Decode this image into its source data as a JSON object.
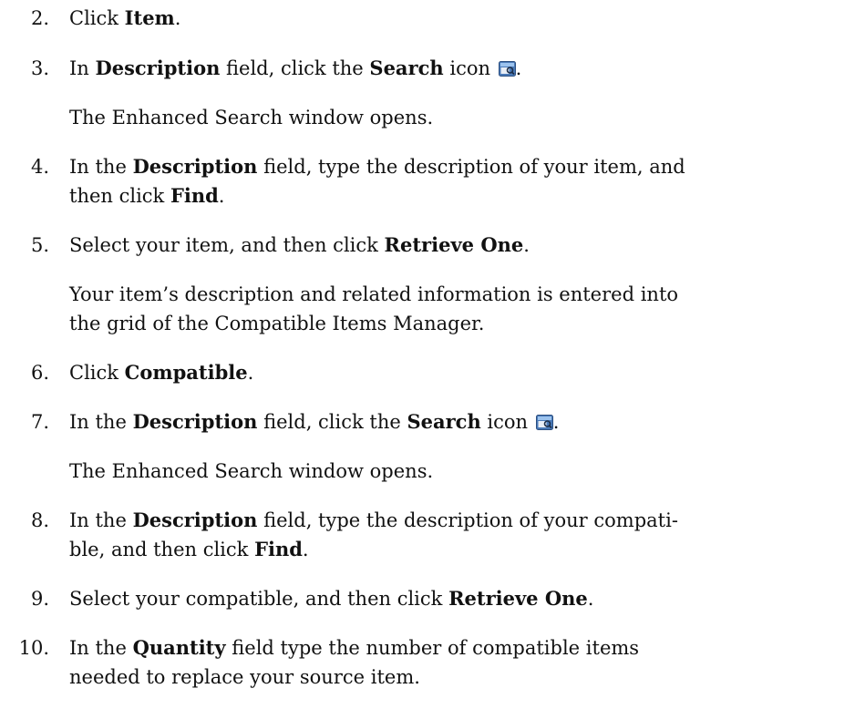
{
  "steps": [
    {
      "num": "2.",
      "parts": [
        "Click ",
        "Item",
        "."
      ]
    },
    {
      "num": "3.",
      "parts": [
        "In ",
        "Description",
        " field, click the ",
        "Search",
        " icon "
      ],
      "end": "."
    },
    {
      "note": "The Enhanced Search window opens."
    },
    {
      "num": "4.",
      "parts": [
        "In the ",
        "Description",
        " field, type the description of your item, and"
      ],
      "line2": [
        "then click ",
        "Find",
        "."
      ]
    },
    {
      "num": "5.",
      "parts": [
        "Select your item, and then click ",
        "Retrieve One",
        "."
      ]
    },
    {
      "note": "Your item’s description and related information is entered into",
      "note2": "the grid of the Compatible Items Manager."
    },
    {
      "num": "6.",
      "parts": [
        "Click ",
        "Compatible",
        "."
      ]
    },
    {
      "num": "7.",
      "parts": [
        "In the ",
        "Description",
        " field, click the ",
        "Search",
        " icon "
      ],
      "end": "."
    },
    {
      "note": "The Enhanced Search window opens."
    },
    {
      "num": "8.",
      "parts": [
        "In the ",
        "Description",
        " field, type the description of your compati-"
      ],
      "line2": [
        "ble, and then click ",
        "Find",
        "."
      ]
    },
    {
      "num": "9.",
      "parts": [
        "Select your compatible, and then click ",
        "Retrieve One",
        "."
      ]
    },
    {
      "num": "10.",
      "parts": [
        "In the ",
        "Quantity",
        " field type the number of compatible items"
      ],
      "line2": [
        "needed to replace your source item."
      ]
    }
  ],
  "icons": {
    "search": "search-icon"
  }
}
